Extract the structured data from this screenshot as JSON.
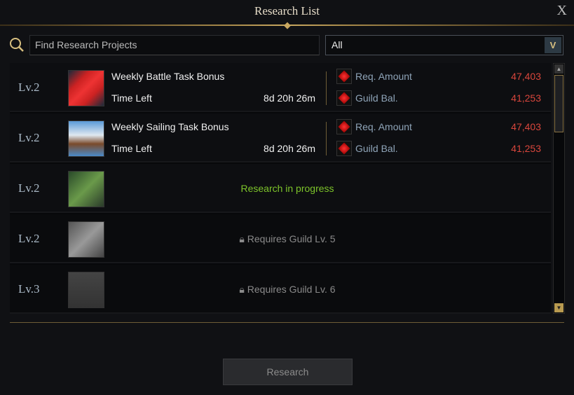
{
  "header": {
    "title": "Research List",
    "close_label": "X"
  },
  "search": {
    "placeholder": "Find Research Projects",
    "filter_value": "All",
    "dropdown_glyph": "V"
  },
  "rows": [
    {
      "level": "Lv.2",
      "name": "Weekly Battle Task Bonus",
      "time_label": "Time Left",
      "time_left": "8d 20h 26m",
      "req_label": "Req. Amount",
      "req_value": "47,403",
      "bal_label": "Guild Bal.",
      "bal_value": "41,253",
      "icon": "battle-banner-icon"
    },
    {
      "level": "Lv.2",
      "name": "Weekly Sailing Task Bonus",
      "time_label": "Time Left",
      "time_left": "8d 20h 26m",
      "req_label": "Req. Amount",
      "req_value": "47,403",
      "bal_label": "Guild Bal.",
      "bal_value": "41,253",
      "icon": "sailing-ship-icon"
    },
    {
      "level": "Lv.2",
      "status": "Research in progress",
      "icon": "scythe-icon"
    },
    {
      "level": "Lv.2",
      "status": "Requires Guild Lv. 5",
      "icon": "tools-icon"
    },
    {
      "level": "Lv.3",
      "status": "Requires Guild Lv. 6",
      "icon": "house-icon"
    }
  ],
  "footer": {
    "research_button": "Research"
  },
  "colors": {
    "accent_gold": "#c9a860",
    "progress_green": "#7dc42a",
    "amount_red": "#d9463c"
  }
}
